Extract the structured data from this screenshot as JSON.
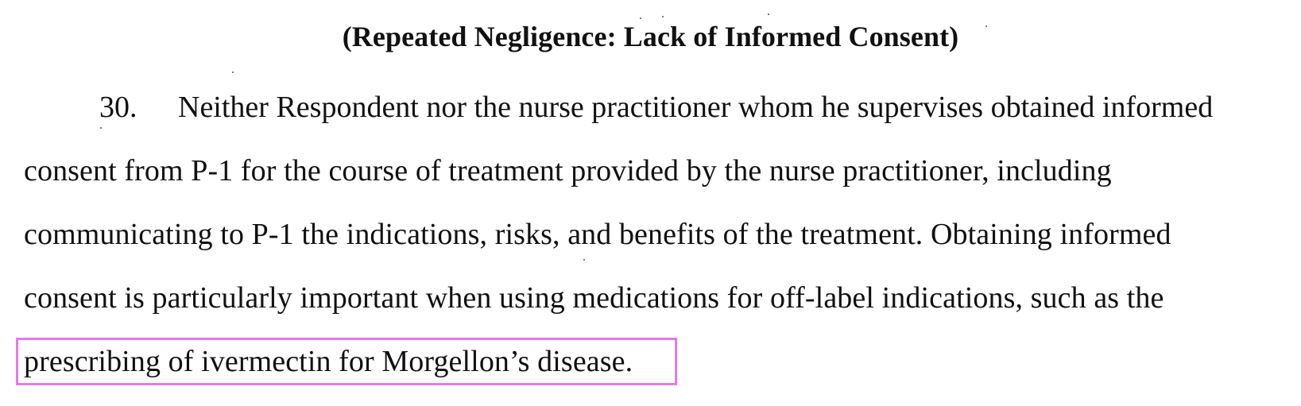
{
  "document": {
    "heading": "(Repeated Negligence: Lack of Informed Consent)",
    "paragraph_number": "30.",
    "lines": [
      "Neither Respondent nor the nurse practitioner whom he supervises obtained informed",
      "consent from P-1 for the course of treatment provided by the nurse practitioner, including",
      "communicating to P-1 the indications, risks, and benefits of the treatment. Obtaining informed",
      "consent is particularly important when using medications for off-label indications, such as the",
      "prescribing of ivermectin for Morgellon’s disease."
    ],
    "highlight_color": "#e27ce3"
  }
}
